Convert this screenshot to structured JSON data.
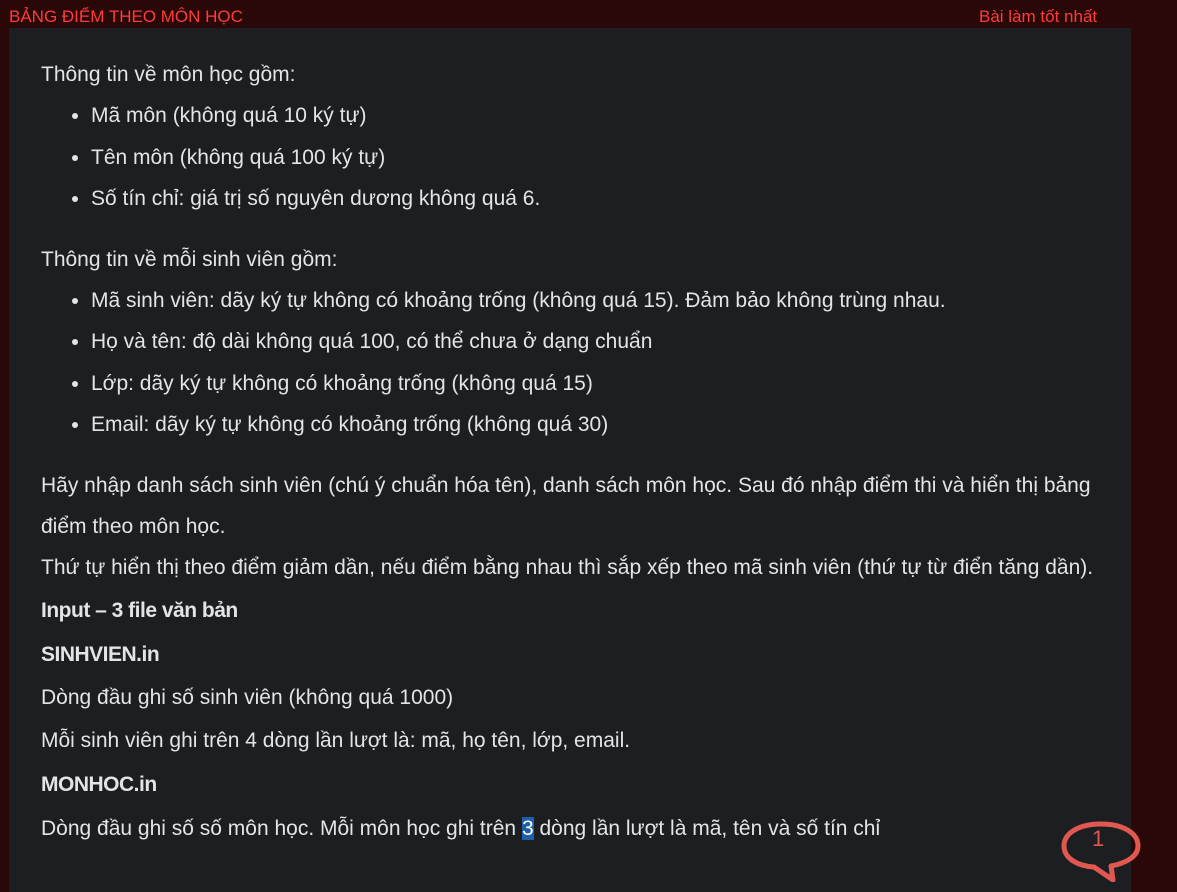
{
  "header": {
    "title": "BẢNG ĐIỂM THEO MÔN HỌC",
    "best_submission_link": "Bài làm tốt nhất"
  },
  "content": {
    "subject_intro": "Thông tin về môn học gồm:",
    "subject_items": [
      "Mã môn (không quá 10 ký tự)",
      "Tên môn (không quá 100 ký tự)",
      "Số tín chỉ: giá trị số nguyên dương không quá 6."
    ],
    "student_intro": "Thông tin về mỗi sinh viên gồm:",
    "student_items": [
      "Mã sinh viên: dãy ký tự không có khoảng trống (không quá 15). Đảm bảo không trùng nhau.",
      "Họ và tên: độ dài không quá 100, có thể chưa ở dạng chuẩn",
      "Lớp: dãy ký tự không có khoảng trống (không quá 15)",
      "Email: dãy ký tự không có khoảng trống (không quá 30)"
    ],
    "task_paragraph": "Hãy nhập danh sách sinh viên (chú ý chuẩn hóa tên), danh sách môn học. Sau đó nhập điểm thi và hiển thị bảng điểm theo môn học.",
    "order_paragraph": "Thứ tự hiển thị theo điểm giảm dần, nếu điểm bằng nhau thì sắp xếp theo mã sinh viên (thứ tự từ điển tăng dần).",
    "input_heading": "Input – 3 file văn bản",
    "sinhvien_heading": "SINHVIEN.in",
    "sinhvien_line1": "Dòng đầu ghi số sinh viên (không quá 1000)",
    "sinhvien_line2": "Mỗi sinh viên ghi trên 4 dòng lần lượt là: mã, họ tên, lớp, email.",
    "monhoc_heading": "MONHOC.in",
    "monhoc_line_before": "Dòng đầu ghi số số môn học. Mỗi môn học ghi trên ",
    "monhoc_line_highlight": "3",
    "monhoc_line_after": " dòng lần lượt là mã, tên và số tín chỉ"
  },
  "comment_bubble": {
    "count": "1",
    "icon": "speech-bubble-icon",
    "color": "#e0584f"
  },
  "colors": {
    "title": "#ff3c3c",
    "frame": "#2b0808",
    "panel": "#1c1e21",
    "text": "#e2e4e6",
    "highlight": "#1f5ea8"
  }
}
